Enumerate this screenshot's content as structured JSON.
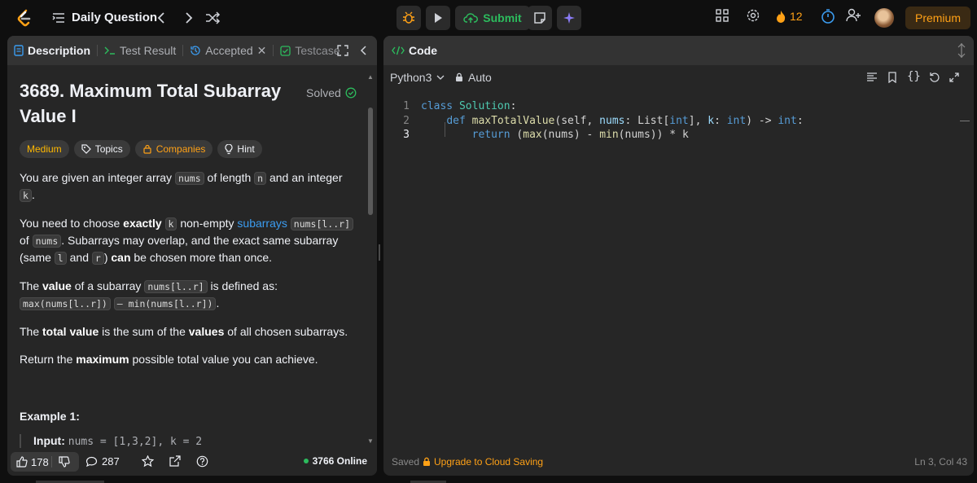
{
  "topbar": {
    "daily_label": "Daily Question",
    "submit_label": "Submit",
    "streak_count": "12",
    "premium_label": "Premium"
  },
  "left_tabs": {
    "description": "Description",
    "test_result": "Test Result",
    "accepted": "Accepted",
    "testcase": "Testcase"
  },
  "problem": {
    "title": "3689. Maximum Total Subarray Value I",
    "status": "Solved",
    "chips": {
      "difficulty": "Medium",
      "topics": "Topics",
      "companies": "Companies",
      "hint": "Hint"
    },
    "p1": {
      "a": "You are given an integer array ",
      "c1": "nums",
      "b": " of length ",
      "c2": "n",
      "c": " and an integer ",
      "c3": "k",
      "d": "."
    },
    "p2": {
      "a": "You need to choose ",
      "b1": "exactly",
      "c1": "k",
      "b": " non-empty ",
      "link": "subarrays",
      "c2": "nums[l..r]",
      "c": " of ",
      "c3": "nums",
      "d": ". Subarrays may overlap, and the exact same subarray (same ",
      "c4": "l",
      "e": " and ",
      "c5": "r",
      "f": ") ",
      "b2": "can",
      "g": " be chosen more than once."
    },
    "p3": {
      "a": "The ",
      "b1": "value",
      "b": " of a subarray ",
      "c1": "nums[l..r]",
      "c": " is defined as: ",
      "c2": "max(nums[l..r])",
      "c3": "– min(nums[l..r])",
      "d": "."
    },
    "p4": {
      "a": "The ",
      "b1": "total value",
      "b": " is the sum of the ",
      "b2": "values",
      "c": " of all chosen subarrays."
    },
    "p5": {
      "a": "Return the ",
      "b1": "maximum",
      "b": " possible total value you can achieve."
    },
    "example_heading": "Example 1:",
    "example_input_label": "Input:",
    "example_input_value": "nums = [1,3,2], k = 2"
  },
  "left_footer": {
    "likes": "178",
    "comments": "287",
    "online": "3766 Online"
  },
  "editor": {
    "tab_label": "Code",
    "language": "Python3",
    "mode": "Auto",
    "lines": [
      {
        "num": "1",
        "parts": [
          [
            "kw",
            "class "
          ],
          [
            "cls",
            "Solution"
          ],
          [
            "tx",
            ":"
          ]
        ]
      },
      {
        "num": "2",
        "parts": [
          [
            "tx",
            "    "
          ],
          [
            "kw",
            "def "
          ],
          [
            "fn",
            "maxTotalValue"
          ],
          [
            "tx",
            "(self, "
          ],
          [
            "param",
            "nums"
          ],
          [
            "tx",
            ": List["
          ],
          [
            "kw",
            "int"
          ],
          [
            "tx",
            "], "
          ],
          [
            "param",
            "k"
          ],
          [
            "tx",
            ": "
          ],
          [
            "kw",
            "int"
          ],
          [
            "tx",
            ") -> "
          ],
          [
            "kw",
            "int"
          ],
          [
            "tx",
            ":"
          ]
        ]
      },
      {
        "num": "3",
        "parts": [
          [
            "tx",
            "        "
          ],
          [
            "kw",
            "return "
          ],
          [
            "tx",
            "("
          ],
          [
            "fn",
            "max"
          ],
          [
            "tx",
            "(nums) - "
          ],
          [
            "fn",
            "min"
          ],
          [
            "tx",
            "(nums)) * k"
          ]
        ]
      }
    ],
    "saved": "Saved",
    "upgrade": "Upgrade to Cloud Saving",
    "cursor": "Ln 3, Col 43"
  },
  "colors": {
    "accent": "#ffa116",
    "green": "#2cbb5d",
    "link": "#3b9cf0",
    "panel": "#262626"
  }
}
